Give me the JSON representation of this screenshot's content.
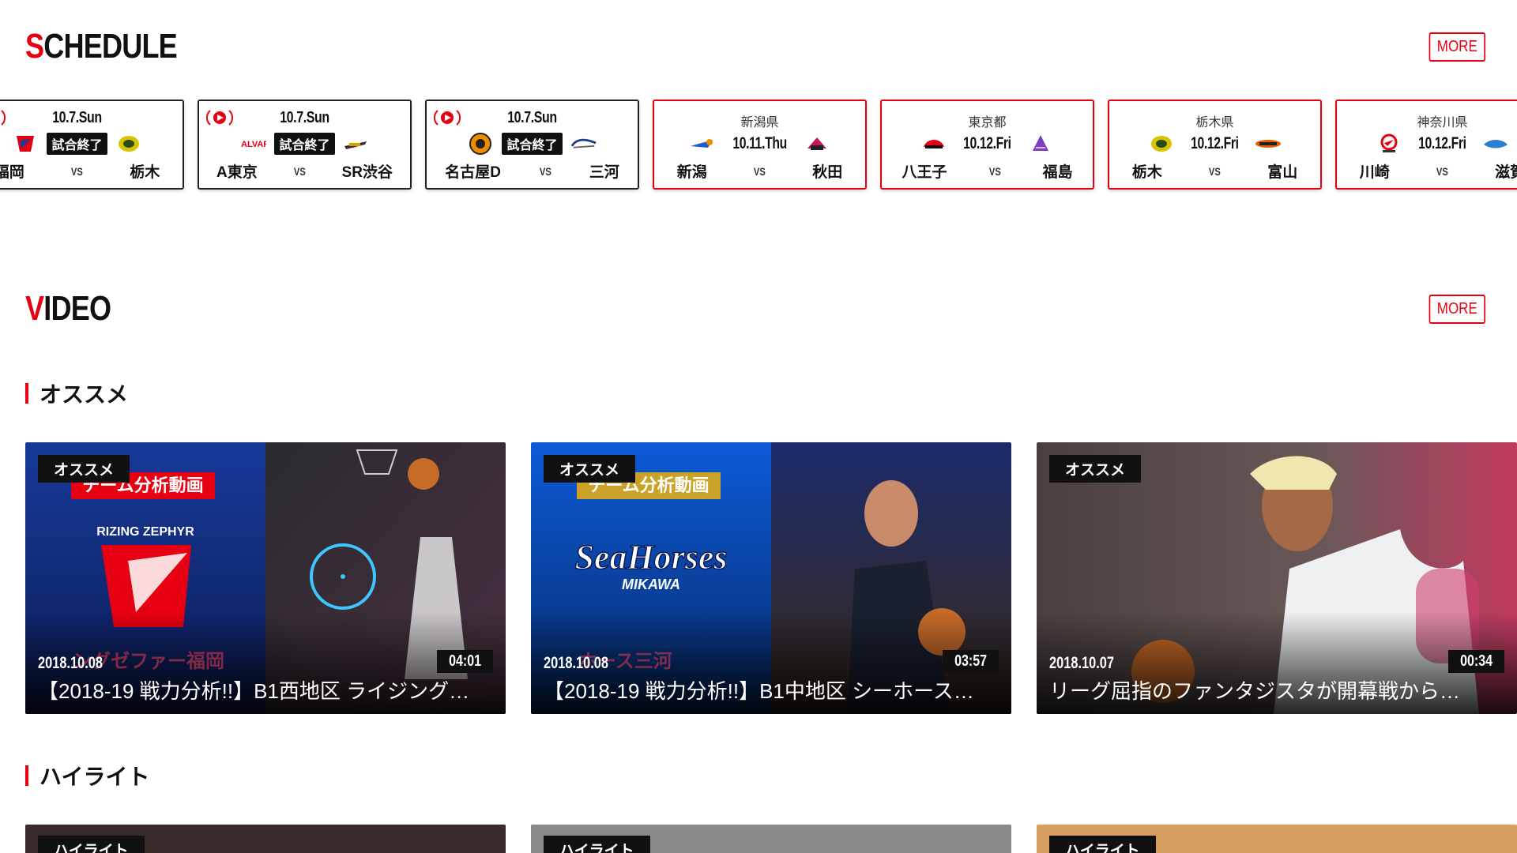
{
  "schedule": {
    "title_first": "S",
    "title_rest": "CHEDULE",
    "more_label": "MORE",
    "games": [
      {
        "top": "10.7.Sun",
        "status": "試合終了",
        "home": "福岡",
        "away": "栃木",
        "vs": "VS",
        "live": true,
        "home_color": "#e60012",
        "away_color": "#d6c400"
      },
      {
        "top": "10.7.Sun",
        "status": "試合終了",
        "home": "A東京",
        "away": "SR渋谷",
        "vs": "VS",
        "live": true,
        "home_color": "#e60012",
        "away_color": "#333333"
      },
      {
        "top": "10.7.Sun",
        "status": "試合終了",
        "home": "名古屋D",
        "away": "三河",
        "vs": "VS",
        "live": true,
        "home_color": "#f08c00",
        "away_color": "#1a3c8a"
      },
      {
        "pref": "新潟県",
        "date": "10.11.Thu",
        "home": "新潟",
        "away": "秋田",
        "vs": "VS",
        "home_color": "#1e5bd0",
        "away_color": "#c2185b"
      },
      {
        "pref": "東京都",
        "date": "10.12.Fri",
        "home": "八王子",
        "away": "福島",
        "vs": "VS",
        "home_color": "#e60012",
        "away_color": "#7b3fc4"
      },
      {
        "pref": "栃木県",
        "date": "10.12.Fri",
        "home": "栃木",
        "away": "富山",
        "vs": "VS",
        "home_color": "#d6c400",
        "away_color": "#e65c00"
      },
      {
        "pref": "神奈川県",
        "date": "10.12.Fri",
        "home": "川崎",
        "away": "滋賀",
        "vs": "VS",
        "home_color": "#e60012",
        "away_color": "#2a7fd0"
      }
    ]
  },
  "video": {
    "title_first": "V",
    "title_rest": "IDEO",
    "more_label": "MORE",
    "recommend_heading": "オススメ",
    "highlight_heading": "ハイライト",
    "recommend": [
      {
        "badge": "オススメ",
        "date": "2018.10.08",
        "duration": "04:01",
        "title": "【2018-19 戦力分析!!】B1西地区 ライジング…",
        "ghost": "ングゼファー福岡",
        "overlay": "チーム分析動画",
        "team": "RIZING ZEPHYR"
      },
      {
        "badge": "オススメ",
        "date": "2018.10.08",
        "duration": "03:57",
        "title": "【2018-19 戦力分析!!】B1中地区 シーホース…",
        "ghost": "ホース三河",
        "overlay": "チーム分析動画",
        "team": "SeaHorses",
        "team_sub": "MIKAWA"
      },
      {
        "badge": "オススメ",
        "date": "2018.10.07",
        "duration": "00:34",
        "title": "リーグ屈指のファンタジスタが開幕戦から…"
      }
    ],
    "highlights": [
      {
        "badge": "ハイライト"
      },
      {
        "badge": "ハイライト"
      },
      {
        "badge": "ハイライト"
      }
    ]
  }
}
